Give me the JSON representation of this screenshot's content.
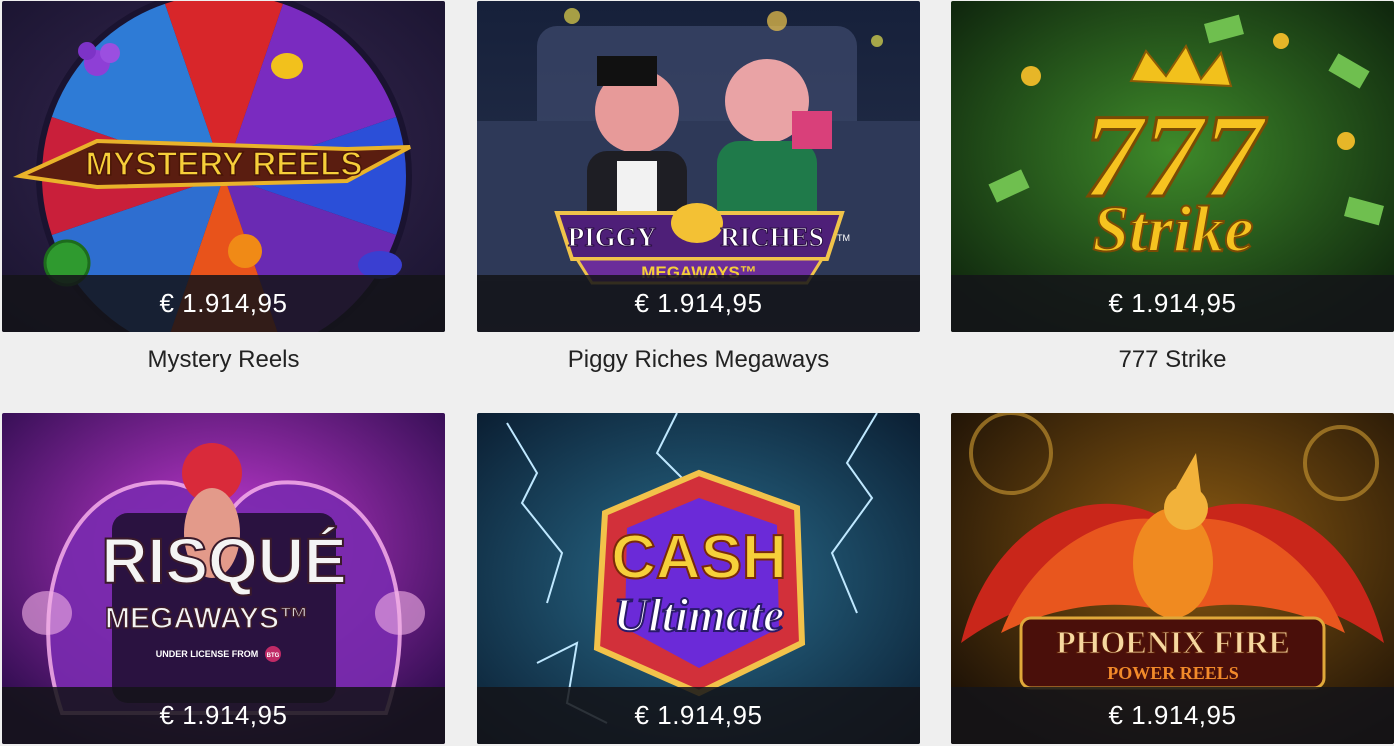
{
  "currency_symbol": "€",
  "games": [
    {
      "title": "Mystery Reels",
      "jackpot": "€ 1.914,95",
      "logo": {
        "line1": "MYSTERY REELS"
      }
    },
    {
      "title": "Piggy Riches Megaways",
      "jackpot": "€ 1.914,95",
      "logo": {
        "line1": "PIGGY",
        "line2": "RICHES",
        "tm": "TM",
        "line3": "MEGAWAYS™"
      }
    },
    {
      "title": "777 Strike",
      "jackpot": "€ 1.914,95",
      "logo": {
        "line1": "777",
        "line2": "Strike"
      }
    },
    {
      "title": "",
      "jackpot": "€ 1.914,95",
      "logo": {
        "line1": "RISQUÉ",
        "line2": "MEGAWAYS™",
        "line3": "UNDER LICENSE FROM",
        "badge": "BTG"
      }
    },
    {
      "title": "",
      "jackpot": "€ 1.914,95",
      "logo": {
        "line1": "CASH",
        "line2": "Ultimate"
      }
    },
    {
      "title": "",
      "jackpot": "€ 1.914,95",
      "logo": {
        "line1": "PHOENIX FIRE",
        "line2": "POWER REELS"
      }
    }
  ],
  "colors": {
    "page_background": "#efefef",
    "jackpot_bar": "#141418",
    "title_text": "#222222"
  }
}
